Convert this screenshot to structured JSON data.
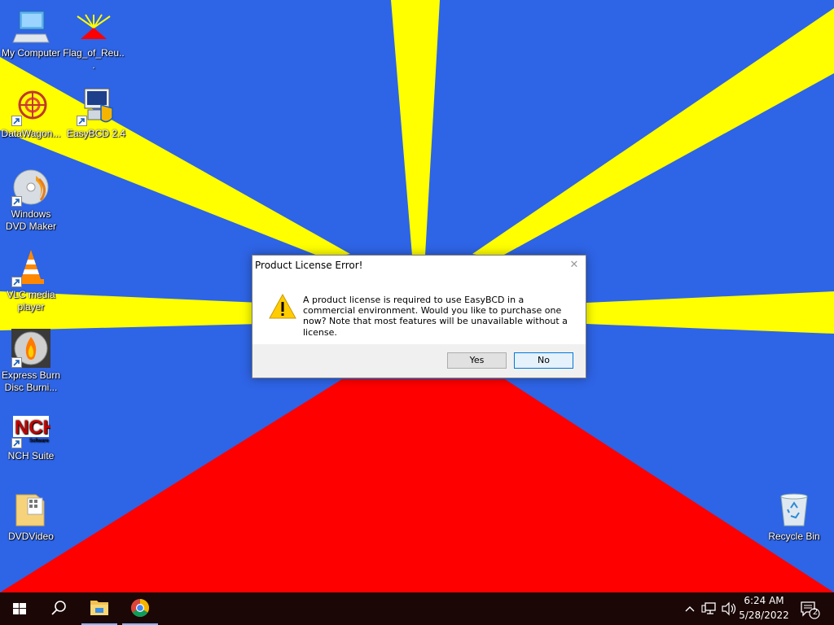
{
  "desktop": {
    "icons": [
      {
        "id": "my-computer",
        "label": "My Computer"
      },
      {
        "id": "flag",
        "label": "Flag_of_Reu..."
      },
      {
        "id": "datawagon",
        "label": "DataWagon..."
      },
      {
        "id": "easybcd",
        "label": "EasyBCD 2.4"
      },
      {
        "id": "dvdmaker",
        "label": "Windows DVD Maker"
      },
      {
        "id": "vlc",
        "label": "VLC media player"
      },
      {
        "id": "expressburn",
        "label": "Express Burn Disc Burni..."
      },
      {
        "id": "nch",
        "label": "NCH Suite"
      },
      {
        "id": "dvdvideo",
        "label": "DVDVideo"
      },
      {
        "id": "recycle",
        "label": "Recycle Bin"
      }
    ],
    "wallpaper_colors": {
      "blue": "#2e64e6",
      "yellow": "#ffff00",
      "red": "#ff0000"
    }
  },
  "dialog": {
    "title": "Product License Error!",
    "message": "A product license is required to use EasyBCD in a commercial environment. Would you like to purchase one now? Note that most features will be unavailable without a license.",
    "yes_label": "Yes",
    "no_label": "No",
    "icon": "warning-icon"
  },
  "taskbar": {
    "time": "6:24 AM",
    "date": "5/28/2022",
    "notification_count": "2",
    "pinned": [
      "windows-start-icon",
      "search-icon",
      "file-explorer-icon",
      "chrome-icon"
    ]
  }
}
